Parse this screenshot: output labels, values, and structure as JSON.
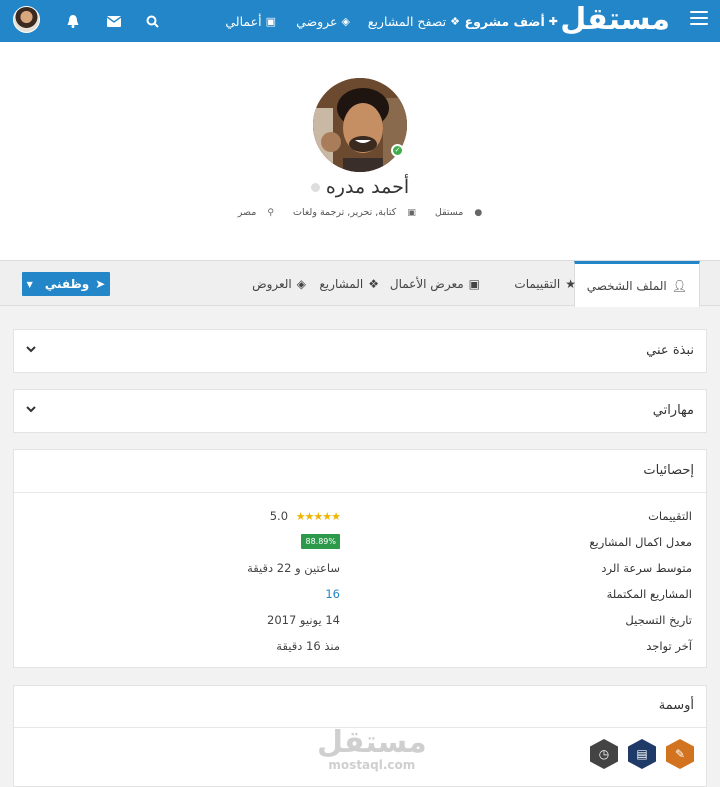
{
  "topbar": {
    "logo": "مستقل",
    "nav": [
      {
        "label": "أضف مشروع",
        "icon": "plus-icon"
      },
      {
        "label": "تصفح المشاريع",
        "icon": "cubes-icon"
      },
      {
        "label": "عروضي",
        "icon": "tag-icon"
      },
      {
        "label": "أعمالي",
        "icon": "briefcase-icon"
      }
    ],
    "icons": [
      "search-icon",
      "envelope-icon",
      "bell-icon"
    ],
    "color": "#2386c8"
  },
  "profile": {
    "name": "أحمد مدره",
    "role": "مستقل",
    "specialty": "كتابة, تحرير, ترجمة ولغات",
    "country": "مصر"
  },
  "tabs": [
    {
      "label": "الملف الشخصي",
      "icon": "user-icon"
    },
    {
      "label": "التقييمات",
      "icon": "star-icon"
    },
    {
      "label": "معرض الأعمال",
      "icon": "briefcase-icon"
    },
    {
      "label": "المشاريع",
      "icon": "cubes-icon"
    },
    {
      "label": "العروض",
      "icon": "tag-icon"
    }
  ],
  "hire_button": {
    "label": "وظفني"
  },
  "sections": {
    "about": "نبذة عني",
    "skills": "مهاراتي",
    "stats": "إحصائيات",
    "badges": "أوسمة"
  },
  "stats": {
    "rating_label": "التقييمات",
    "rating_value": "5.0",
    "rating_stars": 5,
    "completion_label": "معدل اكمال المشاريع",
    "completion_value": "88.89%",
    "response_label": "متوسط سرعة الرد",
    "response_value": "ساعتين و 22 دقيقة",
    "completed_label": "المشاريع المكتملة",
    "completed_value": "16",
    "registered_label": "تاريخ التسجيل",
    "registered_value": "14 يونيو 2017",
    "last_seen_label": "آخر تواجد",
    "last_seen_value": "منذ 16 دقيقة"
  },
  "badges": [
    {
      "icon": "document-icon",
      "color": "#d2741f"
    },
    {
      "icon": "wallet-icon",
      "color": "#1f3a66"
    },
    {
      "icon": "clock-icon",
      "color": "#444444"
    }
  ],
  "watermark": {
    "main": "مستقل",
    "sub": "mostaql.com"
  }
}
